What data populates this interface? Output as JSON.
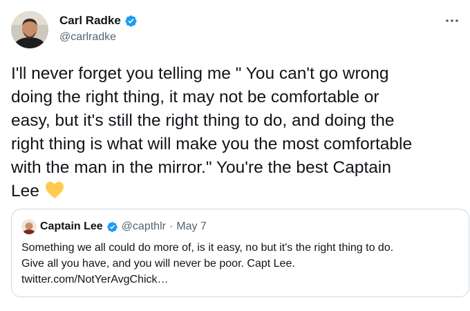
{
  "tweet": {
    "author": {
      "display_name": "Carl Radke",
      "handle": "@carlradke",
      "verified_icon": "verified-badge-icon"
    },
    "more_icon": "more-options-icon",
    "body_lines": [
      "I'll never forget you telling me \" You can't go wrong",
      "doing the right thing, it may not be comfortable or",
      "easy, but it's still the right thing to do, and doing the",
      "right thing is what will make you the most comfortable",
      "with the man in the mirror.\" You're the best Captain",
      "Lee"
    ],
    "emoji": "yellow-heart-icon"
  },
  "quoted_tweet": {
    "display_name": "Captain Lee",
    "handle": "@capthlr",
    "separator": "·",
    "date": "May 7",
    "text_lines": [
      "Something we all could do more of, is it easy, no but it's the right thing to do.",
      "Give all you have, and you will never be poor. Capt Lee.",
      "twitter.com/NotYerAvgChick…"
    ]
  },
  "colors": {
    "text": "#0f1419",
    "secondary_text": "#536471",
    "verified_blue": "#1d9bf0",
    "border": "#cfd9de",
    "heart": "#ffcc4d"
  }
}
